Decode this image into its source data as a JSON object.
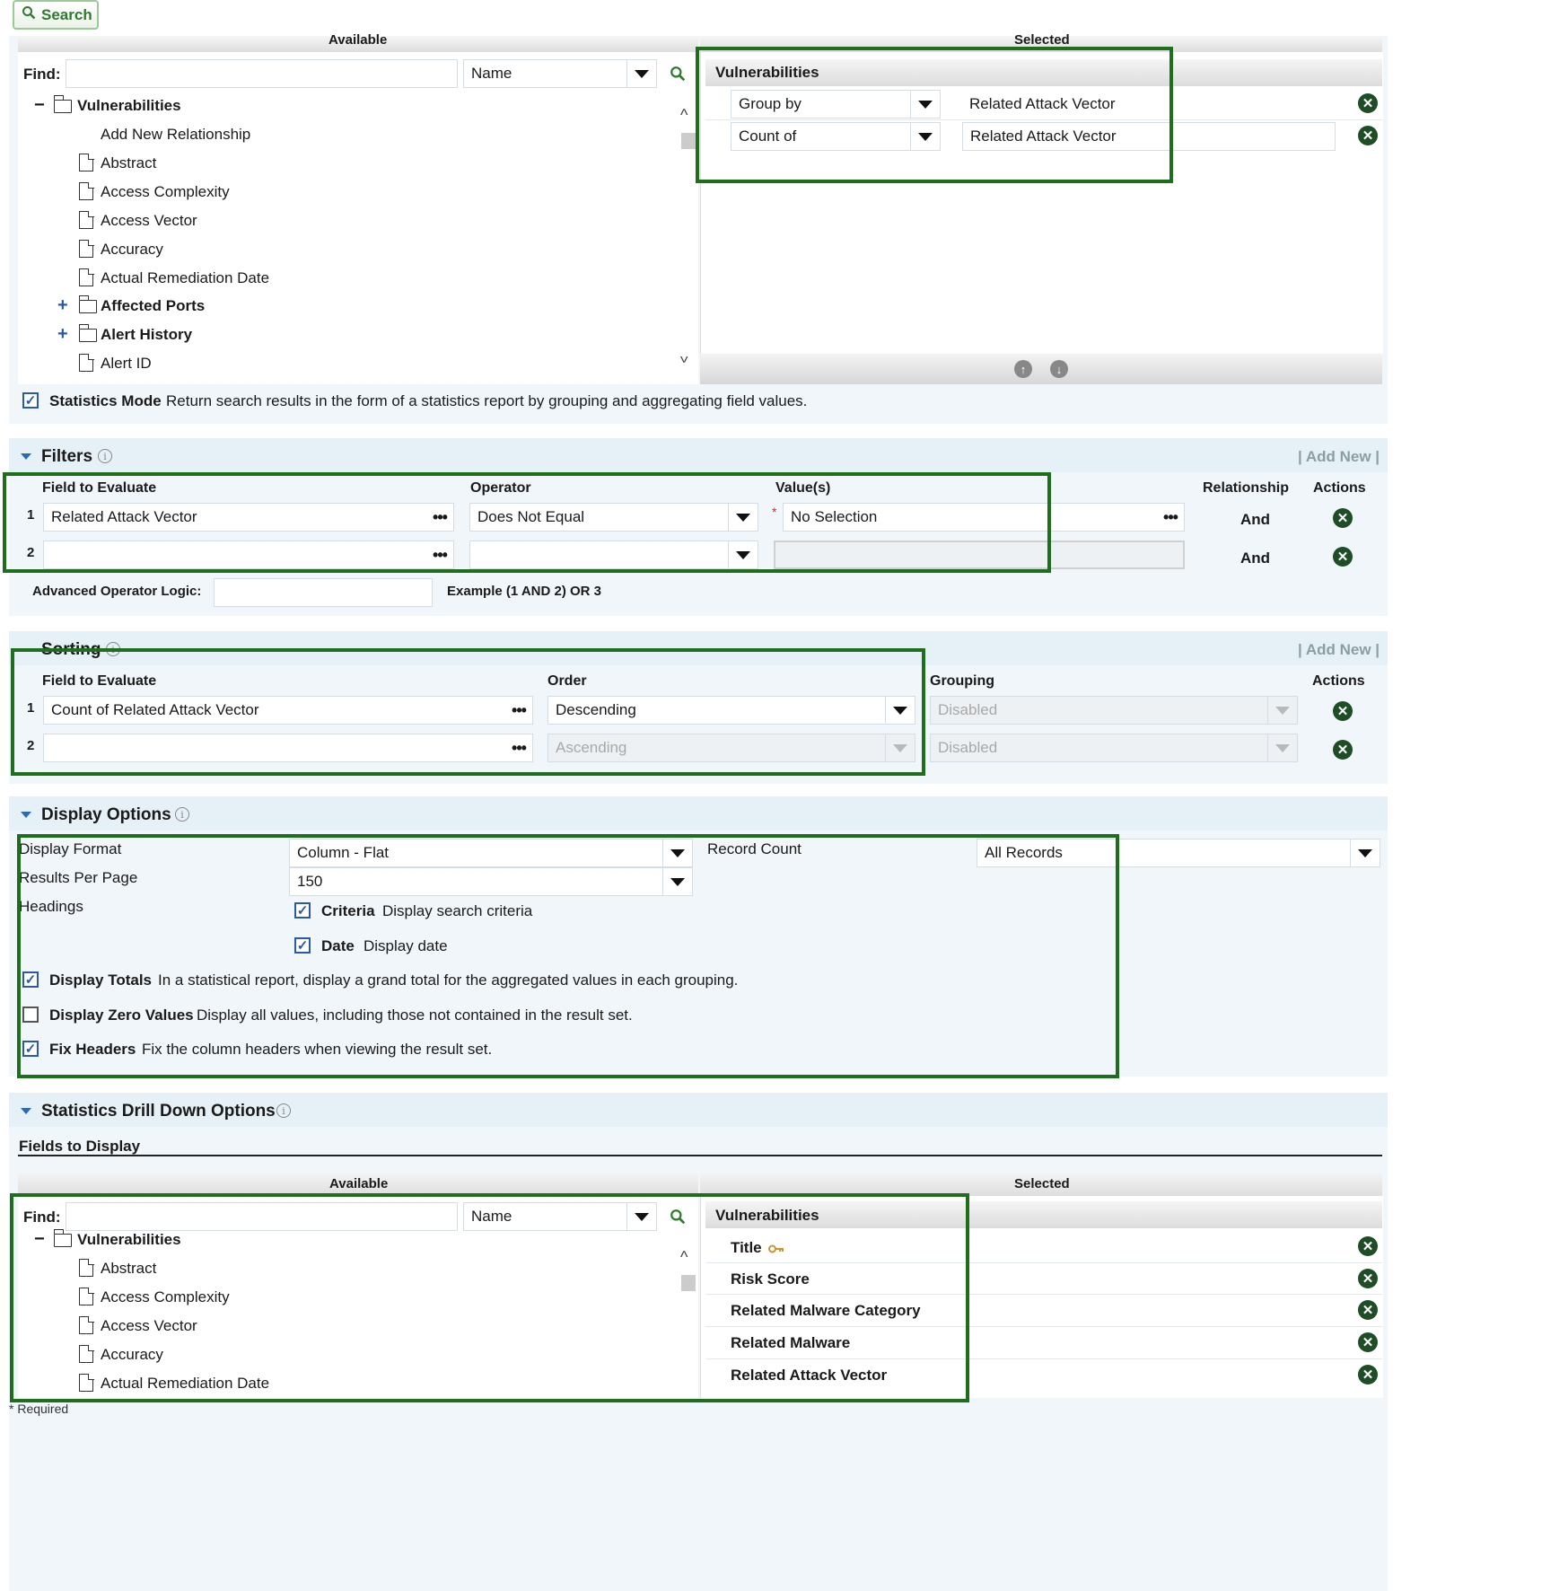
{
  "toolbar": {
    "search_label": "Search"
  },
  "fields_panel": {
    "available_label": "Available",
    "selected_label": "Selected",
    "find_label": "Find:",
    "find_value": "",
    "find_by": "Name",
    "tree_root": "Vulnerabilities",
    "tree_items": [
      {
        "label": "Add New Relationship",
        "type": "action"
      },
      {
        "label": "Abstract",
        "type": "field"
      },
      {
        "label": "Access Complexity",
        "type": "field"
      },
      {
        "label": "Access Vector",
        "type": "field"
      },
      {
        "label": "Accuracy",
        "type": "field"
      },
      {
        "label": "Actual Remediation Date",
        "type": "field"
      },
      {
        "label": "Affected Ports",
        "type": "folder"
      },
      {
        "label": "Alert History",
        "type": "folder"
      },
      {
        "label": "Alert ID",
        "type": "field"
      }
    ],
    "selected_header": "Vulnerabilities",
    "selected_rows": [
      {
        "aggregate": "Group by",
        "field": "Related Attack Vector"
      },
      {
        "aggregate": "Count of",
        "field": "Related Attack Vector"
      }
    ]
  },
  "statistics_mode": {
    "checked": true,
    "label": "Statistics Mode",
    "description": "Return search results in the form of a statistics report by grouping and aggregating field values."
  },
  "filters": {
    "title": "Filters",
    "add_new": "| Add New |",
    "col_field": "Field to Evaluate",
    "col_operator": "Operator",
    "col_values": "Value(s)",
    "col_relationship": "Relationship",
    "col_actions": "Actions",
    "required_mark": "*",
    "rows": [
      {
        "num": "1",
        "field": "Related Attack Vector",
        "operator": "Does Not Equal",
        "value": "No Selection",
        "relationship": "And"
      },
      {
        "num": "2",
        "field": "",
        "operator": "",
        "value": "",
        "relationship": "And"
      }
    ],
    "advanced_label": "Advanced Operator Logic:",
    "advanced_value": "",
    "example": "Example (1 AND 2) OR 3"
  },
  "sorting": {
    "title": "Sorting",
    "add_new": "| Add New |",
    "col_field": "Field to Evaluate",
    "col_order": "Order",
    "col_grouping": "Grouping",
    "col_actions": "Actions",
    "rows": [
      {
        "num": "1",
        "field": "Count of Related Attack Vector",
        "order": "Descending",
        "grouping": "Disabled"
      },
      {
        "num": "2",
        "field": "",
        "order": "Ascending",
        "grouping": "Disabled"
      }
    ]
  },
  "display_options": {
    "title": "Display Options",
    "display_format_label": "Display Format",
    "display_format_value": "Column - Flat",
    "results_per_page_label": "Results Per Page",
    "results_per_page_value": "150",
    "headings_label": "Headings",
    "record_count_label": "Record Count",
    "record_count_value": "All Records",
    "criteria": {
      "checked": true,
      "label": "Criteria",
      "description": "Display search criteria"
    },
    "date": {
      "checked": true,
      "label": "Date",
      "description": "Display date"
    },
    "display_totals": {
      "checked": true,
      "label": "Display Totals",
      "description": "In a statistical report, display a grand total for the aggregated values in each grouping."
    },
    "display_zero": {
      "checked": false,
      "label": "Display Zero Values",
      "description": "Display all values, including those not contained in the result set."
    },
    "fix_headers": {
      "checked": true,
      "label": "Fix Headers",
      "description": "Fix the column headers when viewing the result set."
    }
  },
  "drilldown": {
    "title": "Statistics Drill Down Options",
    "fields_to_display": "Fields to Display",
    "available_label": "Available",
    "selected_label": "Selected",
    "find_label": "Find:",
    "find_value": "",
    "find_by": "Name",
    "tree_root": "Vulnerabilities",
    "tree_items": [
      "Abstract",
      "Access Complexity",
      "Access Vector",
      "Accuracy",
      "Actual Remediation Date"
    ],
    "selected_header": "Vulnerabilities",
    "selected_rows": [
      "Title",
      "Risk Score",
      "Related Malware Category",
      "Related Malware",
      "Related Attack Vector"
    ]
  },
  "footer": {
    "required_note": "* Required"
  },
  "colors": {
    "highlight_border": "#1e6e1e",
    "panel_bg": "#f1f6fb",
    "accent_blue": "#2a5aa5"
  }
}
